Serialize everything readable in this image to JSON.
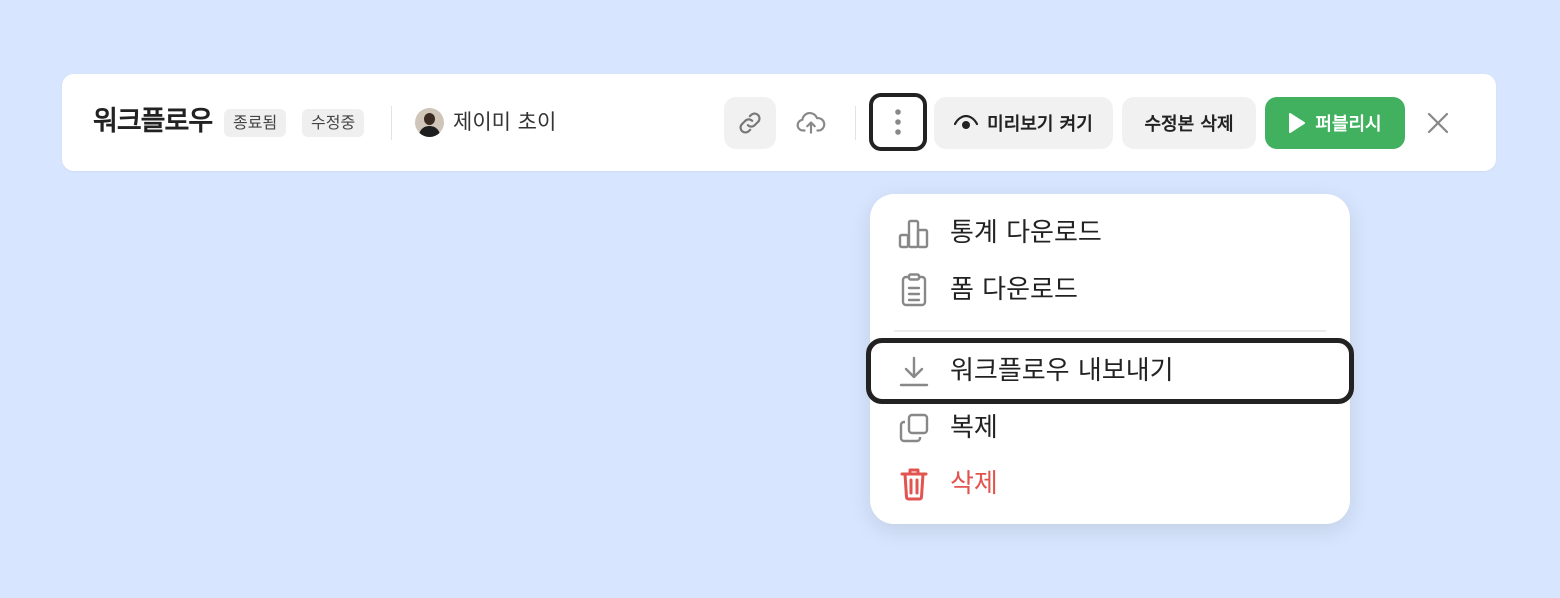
{
  "header": {
    "title": "워크플로우",
    "badges": [
      "종료됨",
      "수정중"
    ],
    "user_name": "제이미 초이",
    "buttons": {
      "preview": "미리보기 켜기",
      "delete_revision": "수정본 삭제",
      "publish": "퍼블리시"
    },
    "icons": {
      "link": "link-icon",
      "upload": "cloud-upload-icon",
      "more": "more-vertical-icon",
      "eye": "eye-icon",
      "play": "play-icon",
      "close": "close-icon"
    }
  },
  "menu": {
    "items": [
      {
        "label": "통계 다운로드",
        "icon": "bar-chart-icon"
      },
      {
        "label": "폼 다운로드",
        "icon": "clipboard-icon"
      },
      {
        "label": "워크플로우 내보내기",
        "icon": "download-icon"
      },
      {
        "label": "복제",
        "icon": "copy-icon"
      },
      {
        "label": "삭제",
        "icon": "trash-icon"
      }
    ]
  },
  "colors": {
    "background": "#d7e5fe",
    "publish": "#41b160",
    "danger": "#e2544f",
    "outline": "#222222"
  }
}
